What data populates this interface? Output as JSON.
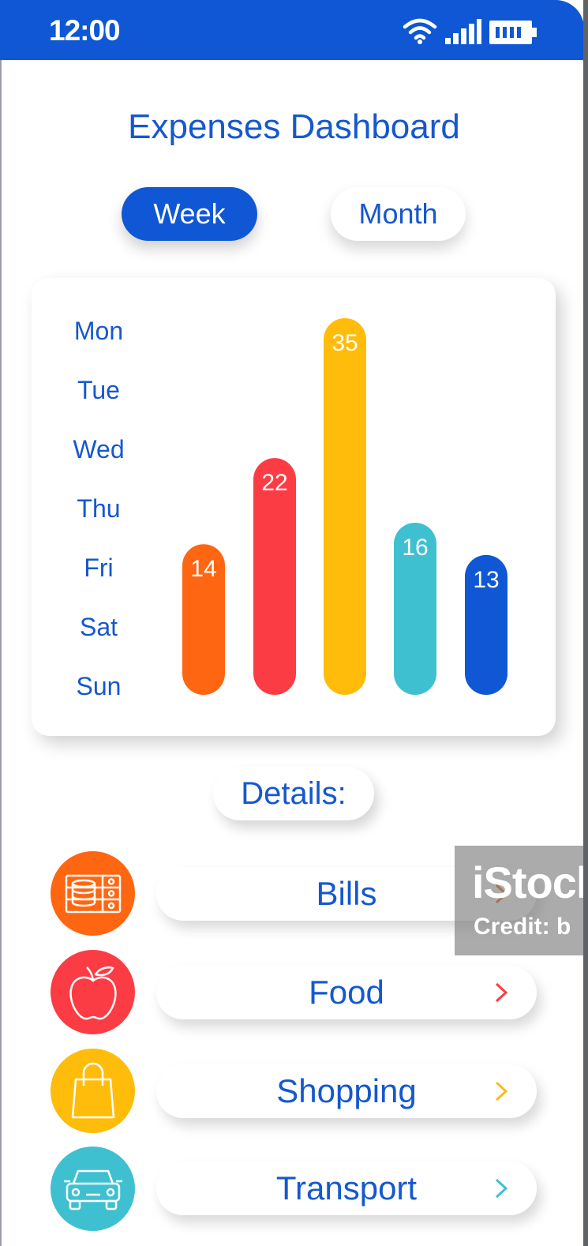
{
  "status_bar": {
    "time": "12:00",
    "icons": [
      "wifi-icon",
      "signal-icon",
      "battery-icon"
    ],
    "color": "#0f57d4"
  },
  "header": {
    "title": "Expenses Dashboard"
  },
  "period_toggle": {
    "week_label": "Week",
    "month_label": "Month",
    "selected": "Week"
  },
  "chart_data": {
    "type": "bar",
    "y_labels": [
      "Mon",
      "Tue",
      "Wed",
      "Thu",
      "Fri",
      "Sat",
      "Sun"
    ],
    "values": [
      14,
      22,
      35,
      16,
      13
    ],
    "colors": [
      "#ff6611",
      "#fc3c44",
      "#ffbc0a",
      "#3fc0d0",
      "#0f57d4"
    ],
    "ylim": [
      0,
      35
    ]
  },
  "details": {
    "heading": "Details:",
    "items": [
      {
        "label": "Bills",
        "icon": "bills-icon",
        "color": "#ff6611"
      },
      {
        "label": "Food",
        "icon": "apple-icon",
        "color": "#fc3c44"
      },
      {
        "label": "Shopping",
        "icon": "shopping-bag-icon",
        "color": "#ffbc0a"
      },
      {
        "label": "Transport",
        "icon": "car-icon",
        "color": "#3fc0d0"
      }
    ]
  },
  "watermark": {
    "brand": "iStock",
    "credit": "Credit: b"
  }
}
